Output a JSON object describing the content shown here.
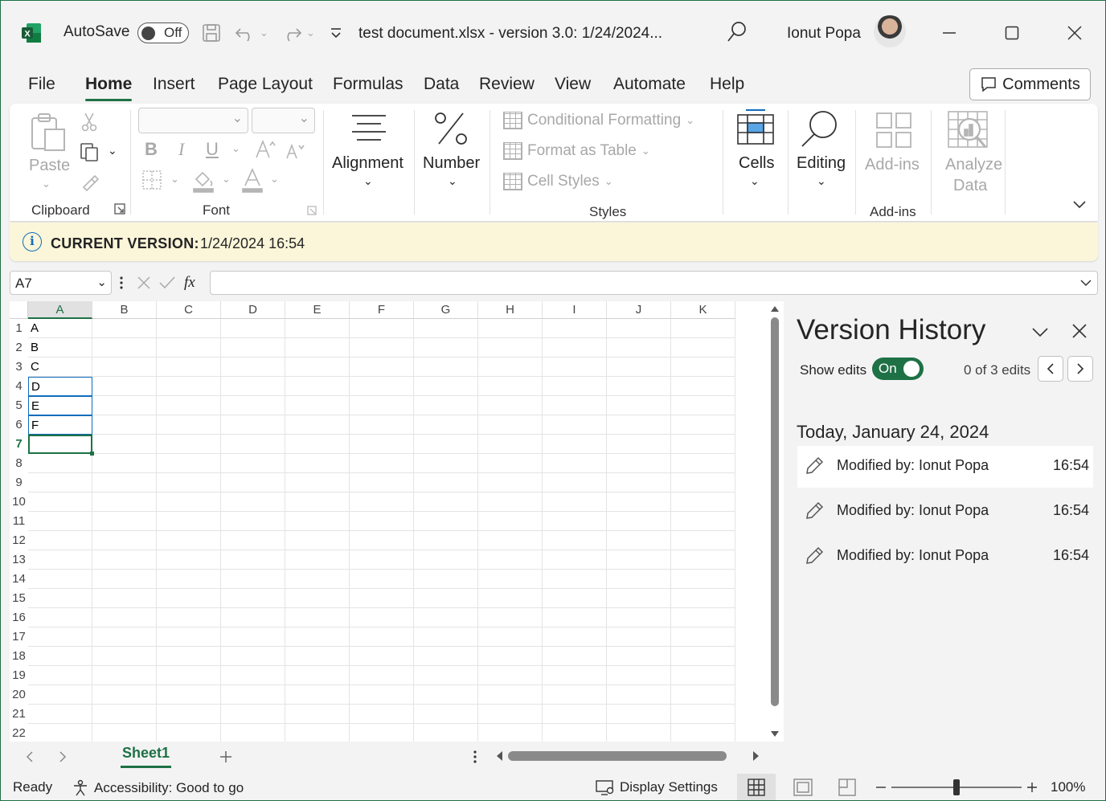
{
  "titlebar": {
    "autosave_label": "AutoSave",
    "autosave_state": "Off",
    "document_title": "test document.xlsx  -  version 3.0: 1/24/2024...",
    "user_name": "Ionut Popa"
  },
  "tabs": [
    "File",
    "Home",
    "Insert",
    "Page Layout",
    "Formulas",
    "Data",
    "Review",
    "View",
    "Automate",
    "Help"
  ],
  "active_tab": "Home",
  "comments_label": "Comments",
  "ribbon": {
    "paste_label": "Paste",
    "clipboard_label": "Clipboard",
    "font_label": "Font",
    "alignment_label": "Alignment",
    "number_label": "Number",
    "conditional_formatting": "Conditional Formatting",
    "format_as_table": "Format as Table",
    "cell_styles": "Cell Styles",
    "styles_label": "Styles",
    "cells_label": "Cells",
    "editing_label": "Editing",
    "addins_button": "Add-ins",
    "addins_group": "Add-ins",
    "analyze_line1": "Analyze",
    "analyze_line2": "Data",
    "font_bold": "B",
    "font_italic": "I",
    "font_underline": "U"
  },
  "infobar": {
    "label": "CURRENT VERSION:",
    "value": "1/24/2024 16:54"
  },
  "formula_bar": {
    "name_box": "A7",
    "fx": "fx",
    "value": ""
  },
  "grid": {
    "columns": [
      "A",
      "B",
      "C",
      "D",
      "E",
      "F",
      "G",
      "H",
      "I",
      "J",
      "K"
    ],
    "rows": [
      "1",
      "2",
      "3",
      "4",
      "5",
      "6",
      "7",
      "8",
      "9",
      "10",
      "11",
      "12",
      "13",
      "14",
      "15",
      "16",
      "17",
      "18",
      "19",
      "20",
      "21",
      "22"
    ],
    "column_a_values": [
      "A",
      "B",
      "C",
      "D",
      "E",
      "F"
    ]
  },
  "sheet_tab": "Sheet1",
  "version_history": {
    "title": "Version History",
    "show_edits_label": "Show edits",
    "toggle_state": "On",
    "edits_count": "0 of 3 edits",
    "day_heading": "Today, January 24, 2024",
    "entries": [
      {
        "who": "Modified by: Ionut Popa",
        "time": "16:54"
      },
      {
        "who": "Modified by: Ionut Popa",
        "time": "16:54"
      },
      {
        "who": "Modified by: Ionut Popa",
        "time": "16:54"
      }
    ]
  },
  "statusbar": {
    "ready": "Ready",
    "accessibility": "Accessibility: Good to go",
    "display_settings": "Display Settings",
    "zoom": "100%"
  },
  "colors": {
    "excel_green": "#1e7145",
    "info_bg": "#fbf6d9",
    "selection_blue": "#0f6cbd"
  }
}
